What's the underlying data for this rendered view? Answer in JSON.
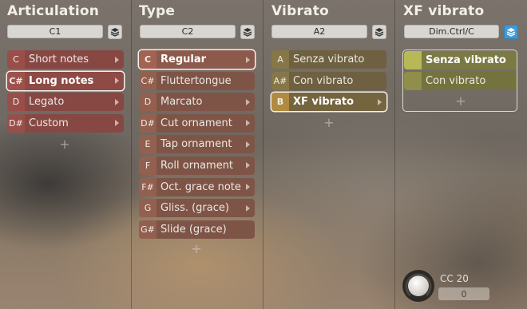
{
  "articulation": {
    "title": "Articulation",
    "selector": "C1",
    "items": [
      {
        "key": "C",
        "label": "Short notes"
      },
      {
        "key": "C#",
        "label": "Long notes"
      },
      {
        "key": "D",
        "label": "Legato"
      },
      {
        "key": "D#",
        "label": "Custom"
      }
    ]
  },
  "type": {
    "title": "Type",
    "selector": "C2",
    "items": [
      {
        "key": "C",
        "label": "Regular"
      },
      {
        "key": "C#",
        "label": "Fluttertongue"
      },
      {
        "key": "D",
        "label": "Marcato"
      },
      {
        "key": "D#",
        "label": "Cut ornament"
      },
      {
        "key": "E",
        "label": "Tap ornament"
      },
      {
        "key": "F",
        "label": "Roll ornament"
      },
      {
        "key": "F#",
        "label": "Oct. grace note"
      },
      {
        "key": "G",
        "label": "Gliss. (grace)"
      },
      {
        "key": "G#",
        "label": "Slide (grace)"
      }
    ]
  },
  "vibrato": {
    "title": "Vibrato",
    "selector": "A2",
    "items": [
      {
        "key": "A",
        "label": "Senza vibrato"
      },
      {
        "key": "A#",
        "label": "Con vibrato"
      },
      {
        "key": "B",
        "label": "XF vibrato"
      }
    ]
  },
  "xf_vibrato": {
    "title": "XF vibrato",
    "selector": "Dim.Ctrl/C",
    "items": [
      {
        "label": "Senza vibrato"
      },
      {
        "label": "Con vibrato"
      }
    ]
  },
  "controller": {
    "label": "CC 20",
    "value": "0"
  },
  "icons": {
    "layer": "layers-icon",
    "add": "plus-icon",
    "submenu": "chevron-right-icon"
  },
  "colors": {
    "articulation_row": "#8a4a45",
    "articulation_key": "#9d4f4a",
    "type_row": "#8b5a4c",
    "type_key": "#a06050",
    "vibrato_row": "#6f6140",
    "vibrato_key": "#8a7a45",
    "xf_row": "#7d7d45",
    "xf_key": "#b9b957",
    "layer_active": "#3f9ad6"
  }
}
